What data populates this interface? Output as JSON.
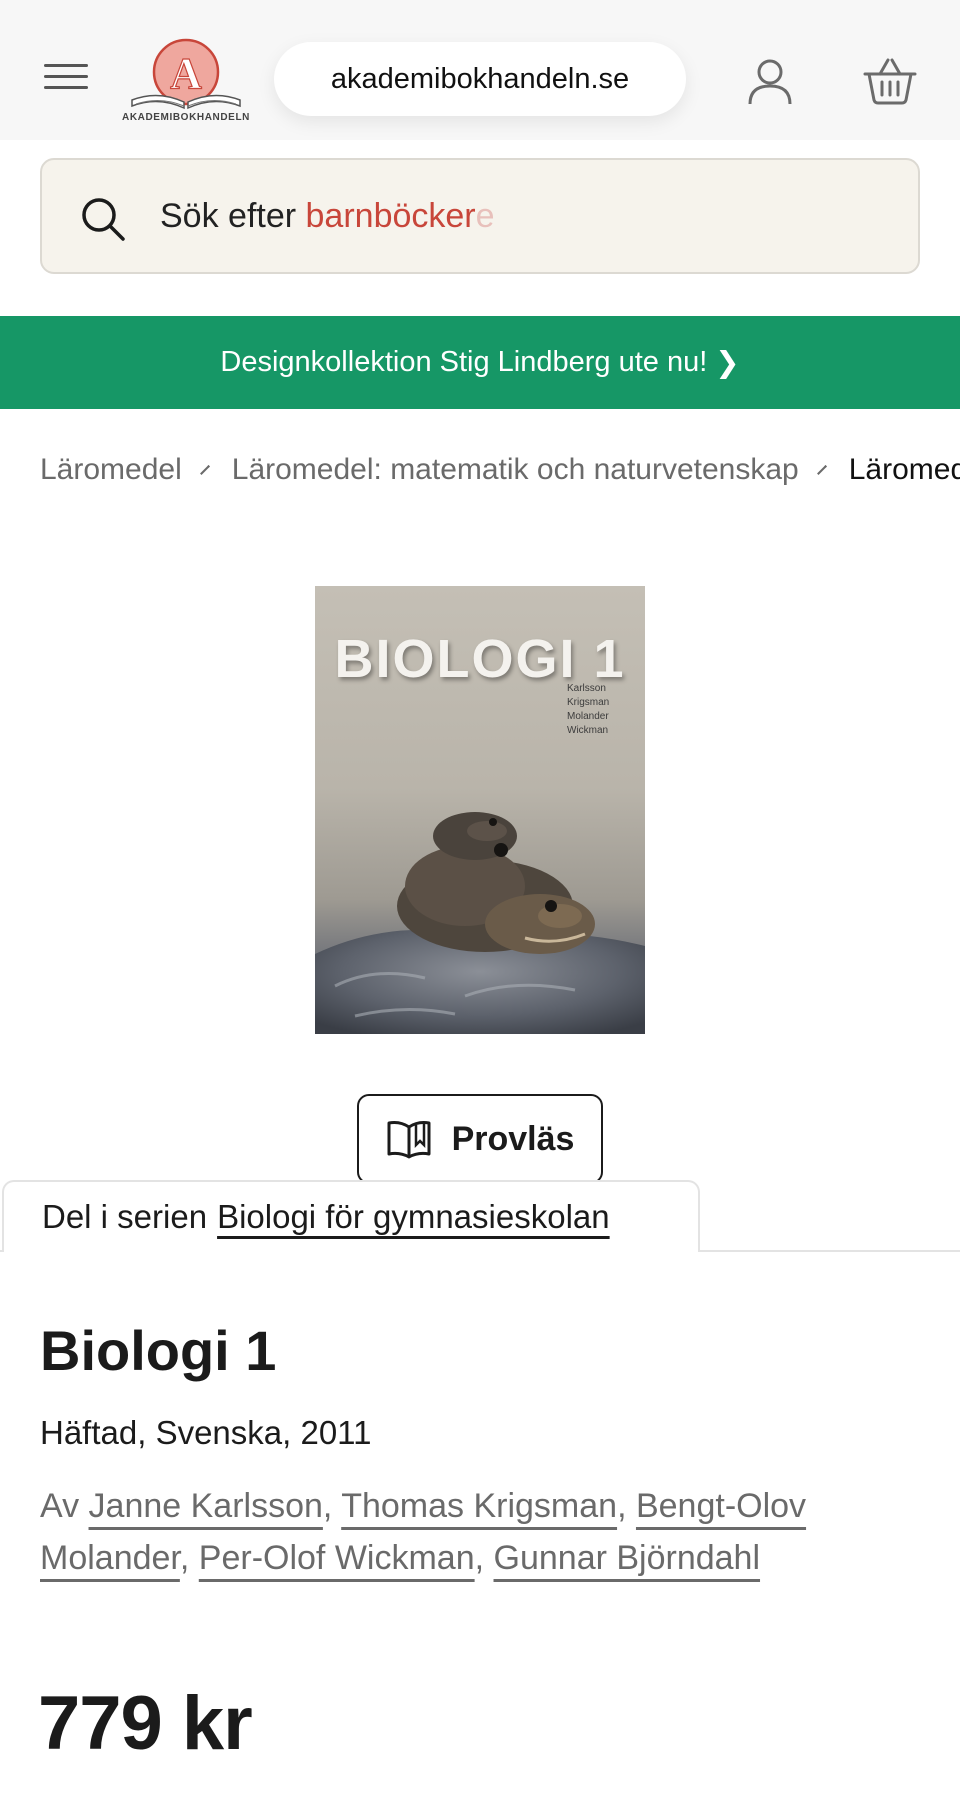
{
  "header": {
    "site_url": "akademibokhandeln.se",
    "logo_text": "AKADEMIBOKHANDELN",
    "logo_letter": "A",
    "brand_color": "#e8877c"
  },
  "search": {
    "prefix": "Sök efter ",
    "highlight": "barnböcker",
    "fade_char": "e",
    "highlight_color": "#c8463a"
  },
  "promo": {
    "text": "Designkollektion Stig Lindberg ute nu!",
    "chevron": "❯",
    "bg_color": "#169766"
  },
  "breadcrumb": {
    "items": [
      "Läromedel",
      "Läromedel: matematik och naturvetenskap",
      "Läromedel"
    ]
  },
  "cover": {
    "title": "BIOLOGI 1",
    "authors": [
      "Karlsson",
      "Krigsman",
      "Molander",
      "Wickman"
    ]
  },
  "preview_button": {
    "label": "Provläs"
  },
  "series": {
    "prefix": "Del i serien",
    "link": "Biologi för gymnasieskolan"
  },
  "product": {
    "title": "Biologi 1",
    "meta": "Häftad, Svenska, 2011",
    "authors_prefix": "Av",
    "authors": [
      "Janne Karlsson",
      "Thomas Krigsman",
      "Bengt-Olov Molander",
      "Per-Olof Wickman",
      "Gunnar Björndahl"
    ],
    "price": "779 kr"
  }
}
